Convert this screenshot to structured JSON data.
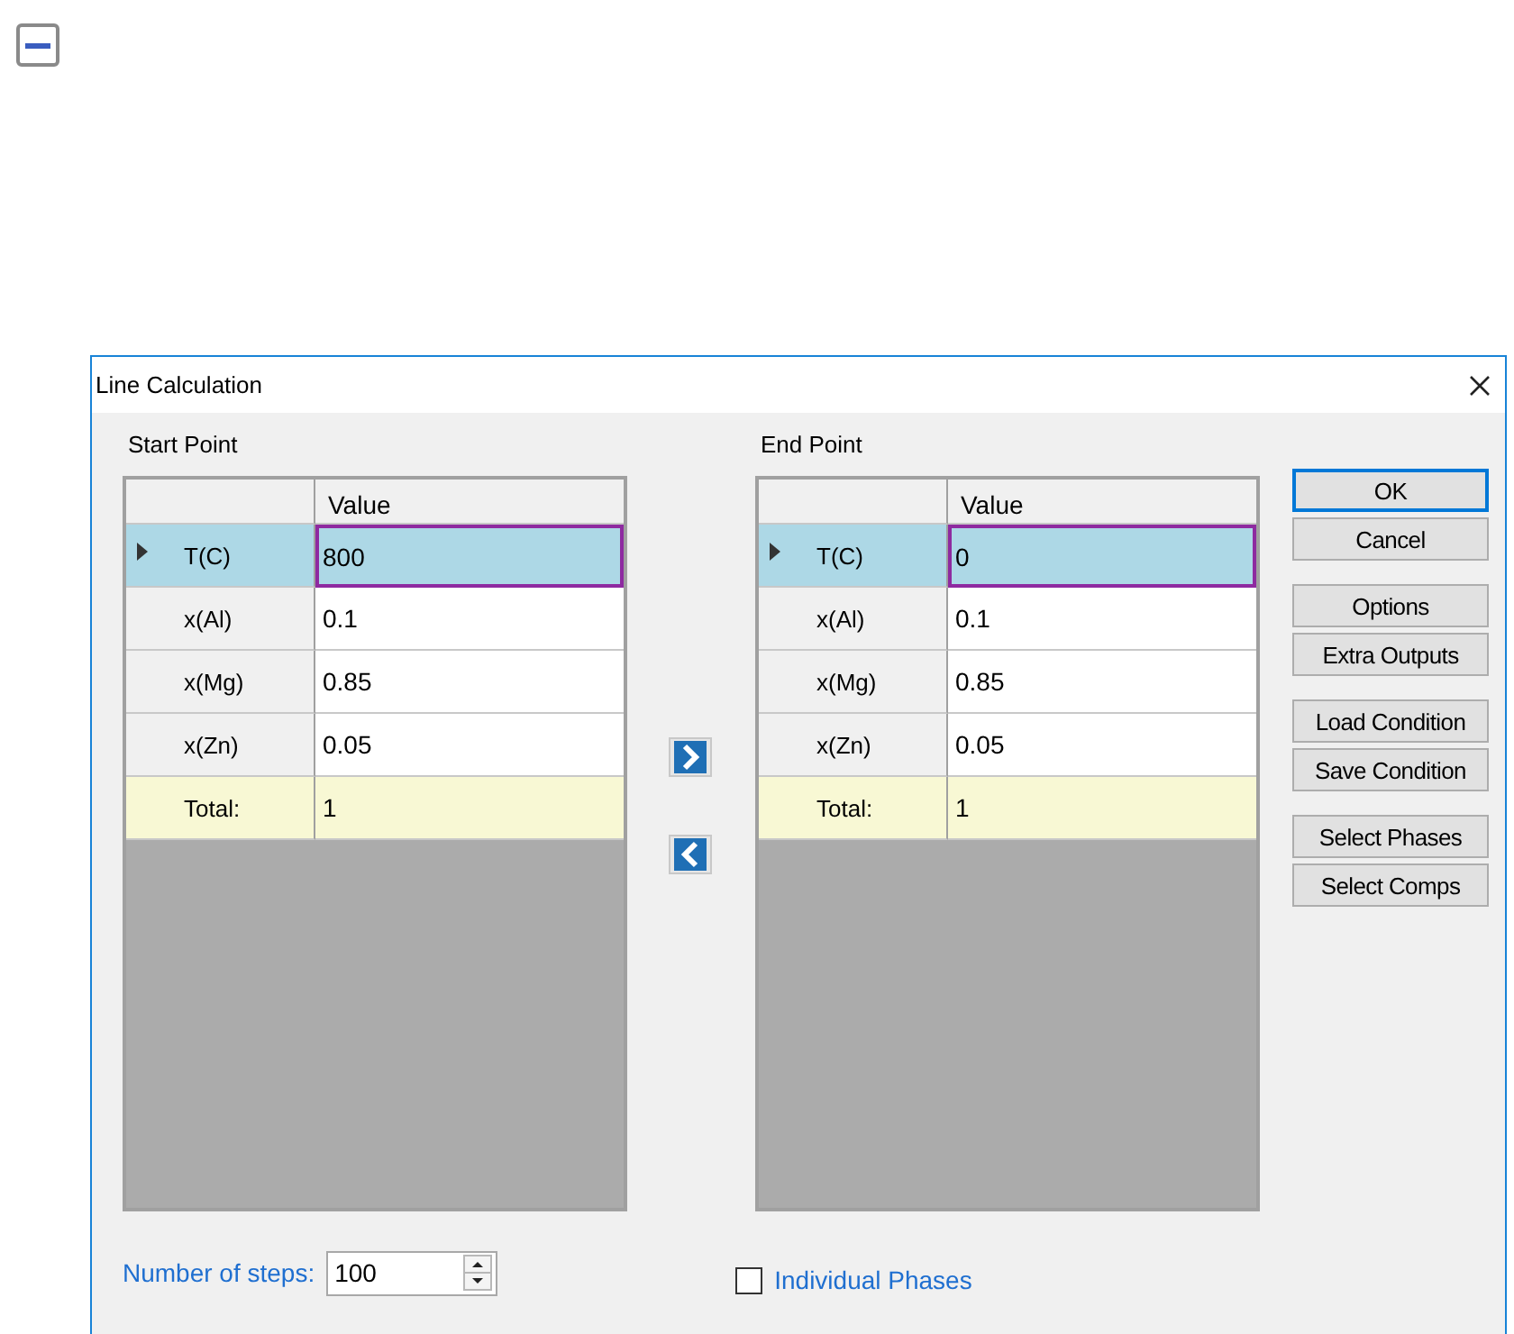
{
  "dialog": {
    "title": "Line Calculation",
    "start_point": {
      "label": "Start Point",
      "value_header": "Value",
      "rows": [
        {
          "kind": "condition",
          "name": "T(C)",
          "value": "800",
          "selected": true
        },
        {
          "kind": "condition",
          "name": "x(Al)",
          "value": "0.1",
          "selected": false
        },
        {
          "kind": "condition",
          "name": "x(Mg)",
          "value": "0.85",
          "selected": false
        },
        {
          "kind": "condition",
          "name": "x(Zn)",
          "value": "0.05",
          "selected": false
        },
        {
          "kind": "total",
          "name": "Total:",
          "value": "1",
          "selected": false
        }
      ]
    },
    "end_point": {
      "label": "End Point",
      "value_header": "Value",
      "rows": [
        {
          "kind": "condition",
          "name": "T(C)",
          "value": "0",
          "selected": true
        },
        {
          "kind": "condition",
          "name": "x(Al)",
          "value": "0.1",
          "selected": false
        },
        {
          "kind": "condition",
          "name": "x(Mg)",
          "value": "0.85",
          "selected": false
        },
        {
          "kind": "condition",
          "name": "x(Zn)",
          "value": "0.05",
          "selected": false
        },
        {
          "kind": "total",
          "name": "Total:",
          "value": "1",
          "selected": false
        }
      ]
    },
    "buttons": [
      {
        "label": "OK",
        "default": true
      },
      {
        "label": "Cancel",
        "default": false
      },
      {
        "label": "Options",
        "default": false
      },
      {
        "label": "Extra Outputs",
        "default": false
      },
      {
        "label": "Load Condition",
        "default": false
      },
      {
        "label": "Save Condition",
        "default": false
      },
      {
        "label": "Select Phases",
        "default": false
      },
      {
        "label": "Select Comps",
        "default": false
      }
    ],
    "steps": {
      "label": "Number of steps:",
      "value": "100"
    },
    "individual_phases": {
      "label": "Individual Phases",
      "checked": false
    }
  }
}
